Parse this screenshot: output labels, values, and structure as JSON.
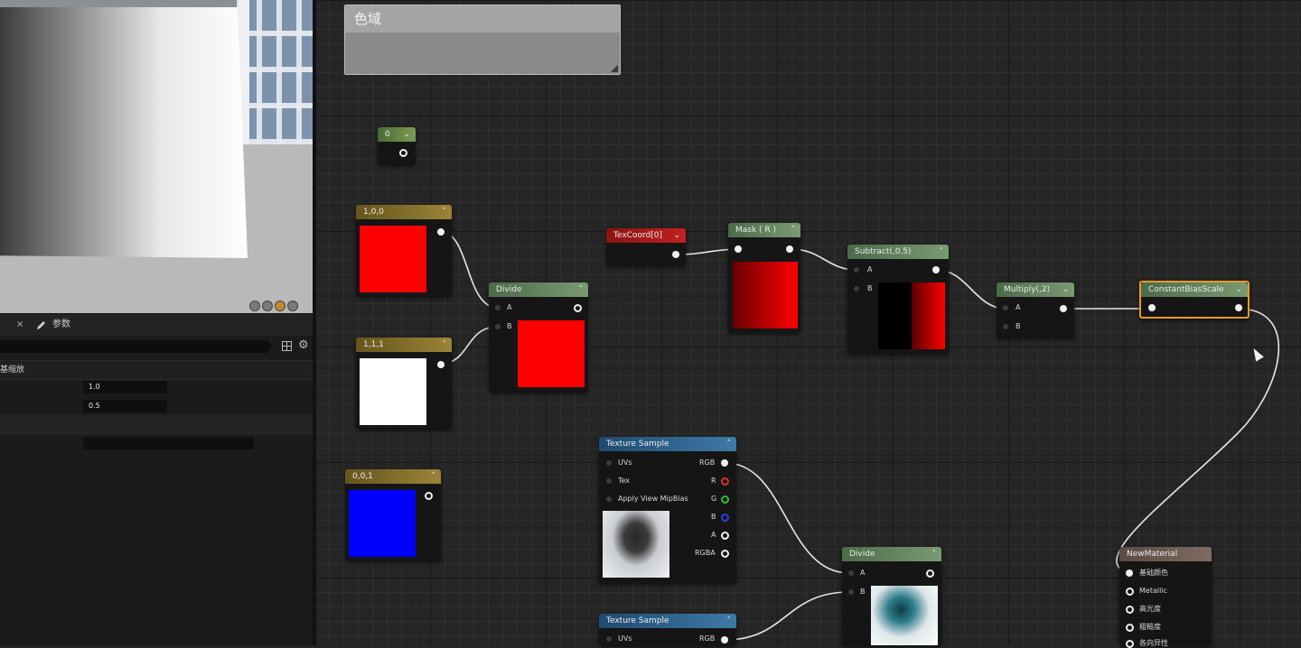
{
  "left_panel": {
    "details_tab": {
      "close_glyph": "×",
      "label": "参数"
    },
    "section_header": "基缩放",
    "properties": [
      {
        "value": "1.0"
      },
      {
        "value": "0.5"
      }
    ]
  },
  "comment": {
    "title": "色域"
  },
  "nodes": {
    "scalar_const": {
      "title": "0"
    },
    "const_red": {
      "title": "1,0,0",
      "swatch_color": "#ff0000"
    },
    "const_white": {
      "title": "1,1,1",
      "swatch_color": "#ffffff"
    },
    "const_blue": {
      "title": "0,0,1",
      "swatch_color": "#0000ff"
    },
    "divide_top": {
      "title": "Divide",
      "pin_a": "A",
      "pin_b": "B",
      "preview_color": "#ff0000"
    },
    "texcoord": {
      "title": "TexCoord[0]"
    },
    "mask": {
      "title": "Mask ( R )"
    },
    "subtract": {
      "title": "Subtract(,0.5)",
      "pin_a": "A",
      "pin_b": "B"
    },
    "multiply": {
      "title": "Multiply(,2)",
      "pin_a": "A",
      "pin_b": "B"
    },
    "constant_bias_scale": {
      "title": "ConstantBiasScale"
    },
    "texture_sample_1": {
      "title": "Texture Sample",
      "inputs": [
        "UVs",
        "Tex",
        "Apply View MipBias"
      ],
      "outputs": [
        "RGB",
        "R",
        "G",
        "B",
        "A",
        "RGBA"
      ]
    },
    "divide_bottom": {
      "title": "Divide",
      "pin_a": "A",
      "pin_b": "B"
    },
    "texture_sample_2": {
      "title": "Texture Sample",
      "input": "UVs",
      "output": "RGB"
    },
    "new_material": {
      "title": "NewMaterial",
      "pins": [
        "基础颜色",
        "Metallic",
        "高光度",
        "粗糙度",
        "各向异性"
      ]
    }
  },
  "colors": {
    "pin_r": "#e03030",
    "pin_g": "#30c030",
    "pin_b": "#3040e0",
    "accent_selected": "#e79a26"
  }
}
